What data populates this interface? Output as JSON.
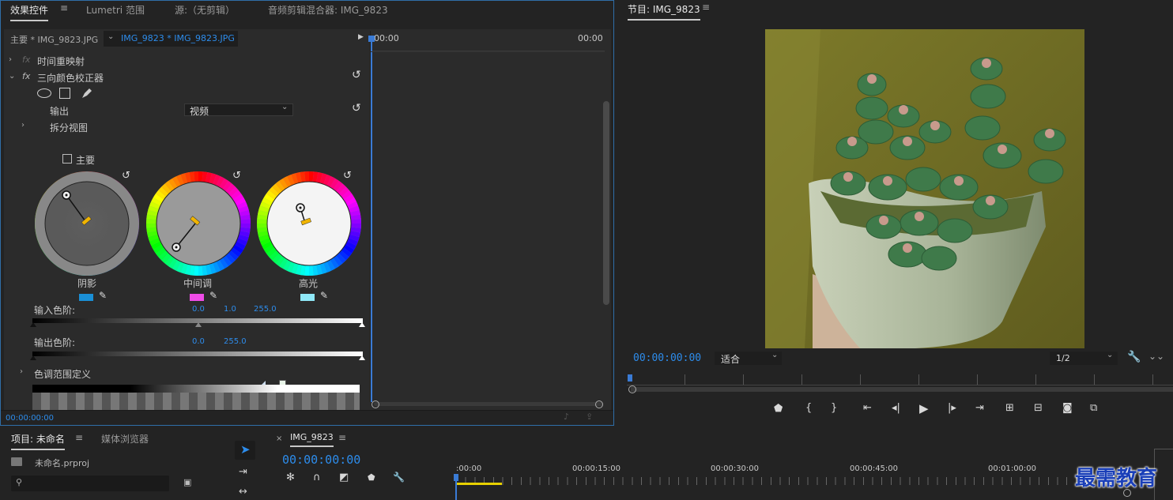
{
  "effect_panel": {
    "tabs": [
      "效果控件",
      "Lumetri 范围",
      "源:（无剪辑）",
      "音频剪辑混合器: IMG_9823"
    ],
    "master_label": "主要 * IMG_9823.JPG",
    "clip_label": "IMG_9823 * IMG_9823.JPG",
    "timeline_tc_left": "00:00",
    "timeline_tc_right": "00:00",
    "rows": {
      "time_remap": "时间重映射",
      "three_way": "三向颜色校正器",
      "output_label": "输出",
      "output_value": "视频",
      "split_view": "拆分视图",
      "master_checkbox": "主要",
      "tonal_range": "色调范围定义"
    },
    "wheels": [
      {
        "label": "阴影",
        "swatch": "#1a8fd6"
      },
      {
        "label": "中间调",
        "swatch": "#f04ce8"
      },
      {
        "label": "高光",
        "swatch": "#8fe8f8"
      }
    ],
    "input_levels": {
      "label": "输入色阶:",
      "values": [
        "0.0",
        "1.0",
        "255.0"
      ]
    },
    "output_levels": {
      "label": "输出色阶:",
      "values": [
        "0.0",
        "255.0"
      ]
    },
    "footer_tc": "00:00:00:00"
  },
  "program": {
    "title": "节目: IMG_9823",
    "timecode": "00:00:00:00",
    "fit": "适合",
    "resolution": "1/2"
  },
  "project": {
    "tabs": [
      "项目: 未命名",
      "媒体浏览器"
    ],
    "file": "未命名.prproj",
    "search_placeholder": ""
  },
  "timeline": {
    "seq_name": "IMG_9823",
    "timecode": "00:00:00:00",
    "ruler": [
      ":00:00",
      "00:00:15:00",
      "00:00:30:00",
      "00:00:45:00",
      "00:01:00:00"
    ]
  },
  "watermark": "最需教育",
  "colors": {
    "accent": "#2d8ceb",
    "bg": "#232323",
    "panel_inner": "#2b2b2b"
  }
}
